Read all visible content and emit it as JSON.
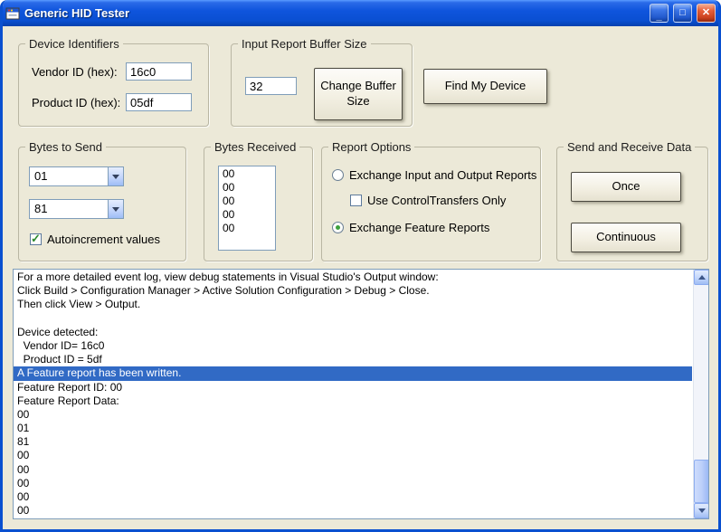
{
  "window": {
    "title": "Generic HID Tester"
  },
  "titlebar_icons": {
    "minimize_glyph": "_",
    "maximize_glyph": "□",
    "close_glyph": "✕"
  },
  "device_identifiers": {
    "title": "Device Identifiers",
    "vendor_id": {
      "label": "Vendor ID (hex):",
      "value": "16c0"
    },
    "product_id": {
      "label": "Product ID (hex):",
      "value": "05df"
    }
  },
  "input_report_buffer": {
    "title": "Input Report Buffer Size",
    "size_value": "32",
    "change_button_label": "Change Buffer Size"
  },
  "find_my_device_label": "Find My Device",
  "bytes_to_send": {
    "title": "Bytes to Send",
    "byte1_selected": "01",
    "byte2_selected": "81",
    "autoincrement": {
      "label": "Autoincrement values",
      "checked": true
    }
  },
  "bytes_received": {
    "title": "Bytes Received",
    "values": [
      "00",
      "00",
      "00",
      "00",
      "00"
    ]
  },
  "report_options": {
    "title": "Report Options",
    "options": [
      {
        "label": "Exchange Input and Output Reports",
        "type": "radio",
        "selected": false
      },
      {
        "label": "Use ControlTransfers Only",
        "type": "checkbox",
        "checked": false
      },
      {
        "label": "Exchange Feature Reports",
        "type": "radio",
        "selected": true
      }
    ]
  },
  "send_receive": {
    "title": "Send and Receive Data",
    "once_label": "Once",
    "continuous_label": "Continuous"
  },
  "log": {
    "selected_index": 7,
    "lines": [
      "For a more detailed event log, view debug statements in Visual Studio's Output window:",
      "Click Build > Configuration Manager > Active Solution Configuration > Debug > Close.",
      "Then click View > Output.",
      "",
      "Device detected:",
      "  Vendor ID= 16c0",
      "  Product ID = 5df",
      "A Feature report has been written.",
      "Feature Report ID: 00",
      "Feature Report Data:",
      "00",
      "01",
      "81",
      "00",
      "00",
      "00",
      "00",
      "00"
    ]
  }
}
